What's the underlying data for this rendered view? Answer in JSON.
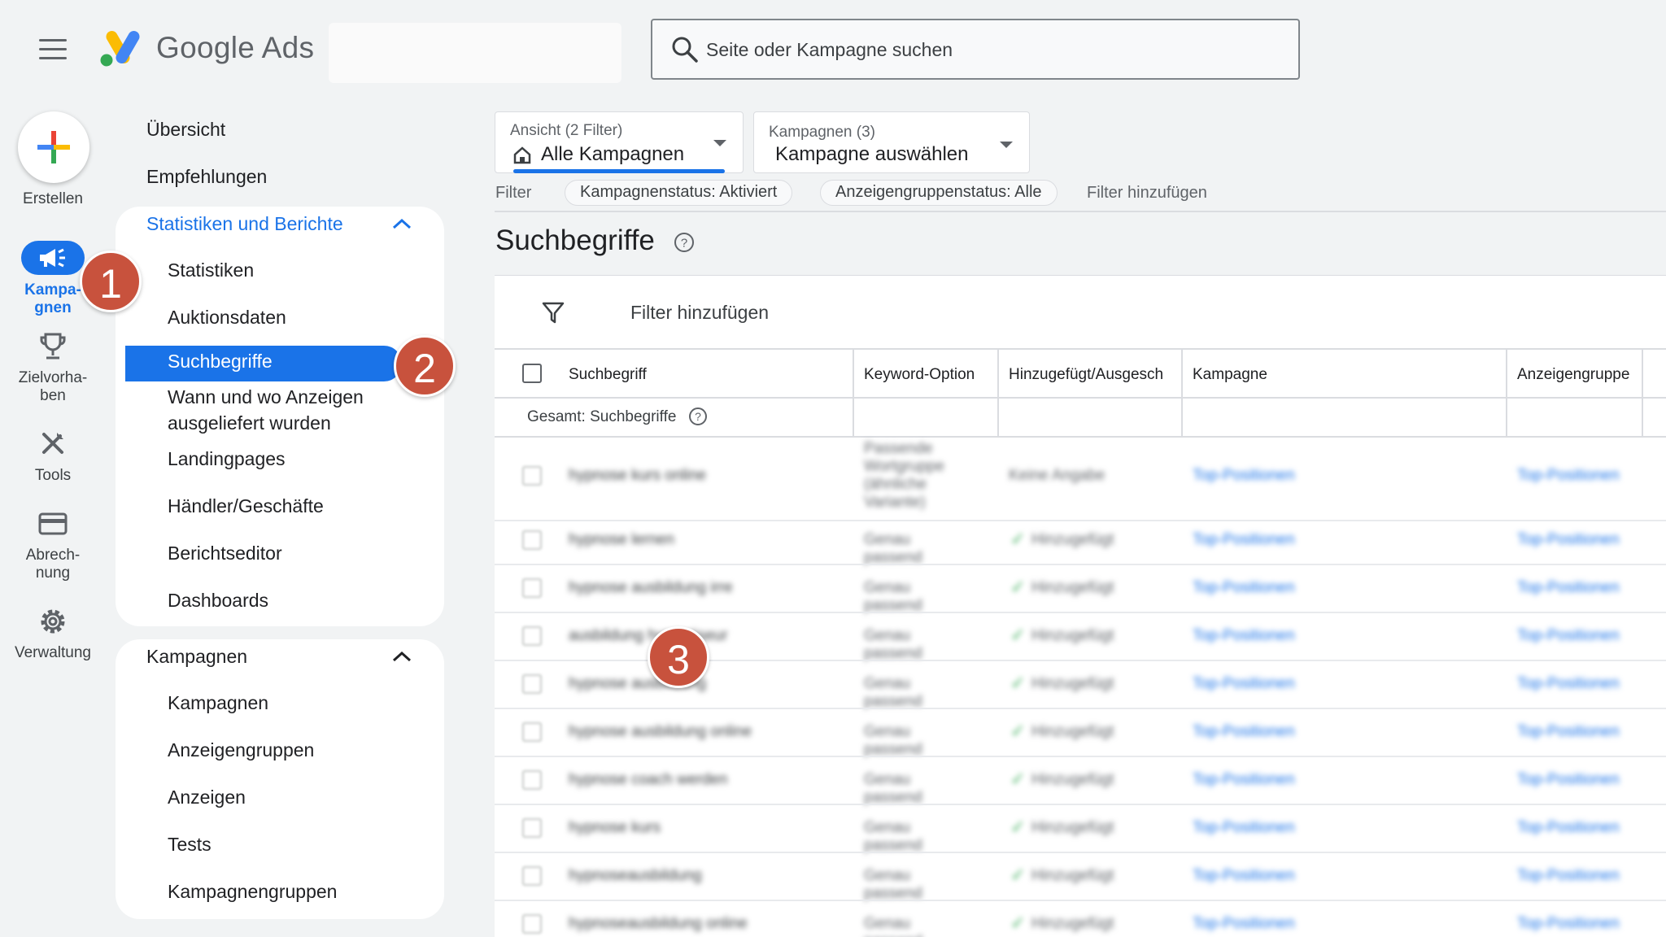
{
  "brand": {
    "name": "Google Ads"
  },
  "search": {
    "placeholder": "Seite oder Kampagne suchen"
  },
  "rail": {
    "create_label": "Erstellen",
    "campaigns_label": "Kampa-\ngnen",
    "goals_label": "Zielvorha-\nben",
    "tools_label": "Tools",
    "billing_label": "Abrech-\nnung",
    "admin_label": "Verwaltung"
  },
  "nav": {
    "overview": "Übersicht",
    "recommendations": "Empfehlungen",
    "reports_section": {
      "title": "Statistiken und Berichte",
      "items": [
        "Statistiken",
        "Auktionsdaten",
        "Suchbegriffe",
        "Wann und wo Anzeigen ausgeliefert wurden",
        "Landingpages",
        "Händler/Geschäfte",
        "Berichtseditor",
        "Dashboards"
      ]
    },
    "campaigns_section": {
      "title": "Kampagnen",
      "items": [
        "Kampagnen",
        "Anzeigengruppen",
        "Anzeigen",
        "Tests",
        "Kampagnengruppen"
      ]
    }
  },
  "view_dropdown": {
    "label": "Ansicht (2 Filter)",
    "value": "Alle Kampagnen"
  },
  "campaign_dropdown": {
    "label": "Kampagnen (3)",
    "value": "Kampagne auswählen"
  },
  "filters": {
    "label": "Filter",
    "chips": [
      "Kampagnenstatus: Aktiviert",
      "Anzeigengruppenstatus: Alle"
    ],
    "add": "Filter hinzufügen"
  },
  "page": {
    "title": "Suchbegriffe"
  },
  "table": {
    "filter_add": "Filter hinzufügen",
    "columns": [
      "Suchbegriff",
      "Keyword-Option",
      "Hinzugefügt/Ausgesch",
      "Kampagne",
      "Anzeigengruppe"
    ],
    "total_label": "Gesamt: Suchbegriffe",
    "rows": [
      {
        "term": "hypnose kurs online",
        "match": "Passende Wortgruppe (ähnliche Variante)",
        "status": "Keine Angabe",
        "campaign": "Top-Positionen",
        "adgroup": "Top-Positionen"
      },
      {
        "term": "hypnose lernen",
        "match": "Genau passend",
        "status": "Hinzugefügt",
        "campaign": "Top-Positionen",
        "adgroup": "Top-Positionen"
      },
      {
        "term": "hypnose ausbildung irre",
        "match": "Genau passend",
        "status": "Hinzugefügt",
        "campaign": "Top-Positionen",
        "adgroup": "Top-Positionen"
      },
      {
        "term": "ausbildung hypnotiseur",
        "match": "Genau passend",
        "status": "Hinzugefügt",
        "campaign": "Top-Positionen",
        "adgroup": "Top-Positionen"
      },
      {
        "term": "hypnose ausbildung",
        "match": "Genau passend",
        "status": "Hinzugefügt",
        "campaign": "Top-Positionen",
        "adgroup": "Top-Positionen"
      },
      {
        "term": "hypnose ausbildung online",
        "match": "Genau passend",
        "status": "Hinzugefügt",
        "campaign": "Top-Positionen",
        "adgroup": "Top-Positionen"
      },
      {
        "term": "hypnose coach werden",
        "match": "Genau passend",
        "status": "Hinzugefügt",
        "campaign": "Top-Positionen",
        "adgroup": "Top-Positionen"
      },
      {
        "term": "hypnose kurs",
        "match": "Genau passend",
        "status": "Hinzugefügt",
        "campaign": "Top-Positionen",
        "adgroup": "Top-Positionen"
      },
      {
        "term": "hypnoseausbildung",
        "match": "Genau passend",
        "status": "Hinzugefügt",
        "campaign": "Top-Positionen",
        "adgroup": "Top-Positionen"
      },
      {
        "term": "hypnoseausbildung online",
        "match": "Genau passend",
        "status": "Hinzugefügt",
        "campaign": "Top-Positionen",
        "adgroup": "Top-Positionen"
      }
    ]
  },
  "badges": [
    "1",
    "2",
    "3"
  ],
  "colors": {
    "accent": "#1a73e8",
    "badge": "#c8523d",
    "check": "#34a853"
  }
}
